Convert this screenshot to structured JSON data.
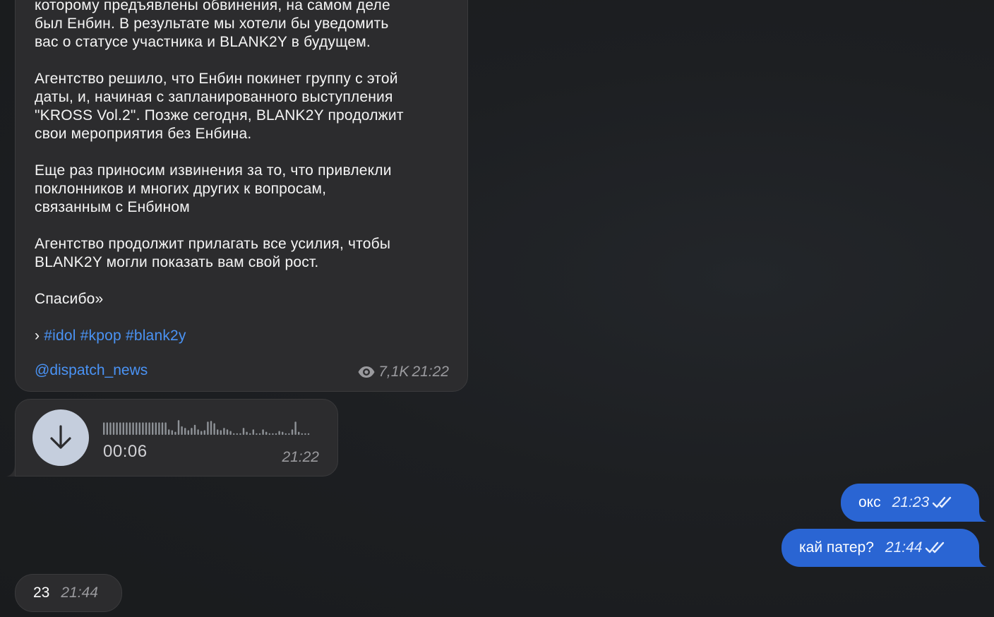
{
  "post": {
    "paragraphs": [
      [
        "которому предъявлены обвинения, на самом деле",
        "был Енбин. В результате мы хотели бы уведомить",
        "вас о статусе участника и BLANK2Y в будущем."
      ],
      [
        "Агентство решило, что Енбин покинет группу с этой",
        "даты, и, начиная с запланированного выступления",
        "\"KROSS Vol.2\". Позже сегодня, BLANK2Y продолжит",
        "свои мероприятия без Енбина."
      ],
      [
        "Еще раз приносим извинения за то, что привлекли",
        "поклонников и многих других к вопросам,",
        "связанным с Енбином"
      ],
      [
        "Агентство продолжит прилагать все усилия, чтобы",
        "BLANK2Y могли показать вам свой рост."
      ],
      [
        "Спасибо»"
      ]
    ],
    "hashtag_prefix": "›",
    "hashtags": [
      "#idol",
      "#kpop",
      "#blank2y"
    ],
    "channel": "@dispatch_news",
    "views": "7,1K",
    "time": "21:22",
    "views_icon": "eye-icon"
  },
  "voice": {
    "duration": "00:06",
    "time": "21:22",
    "icon": "download-arrow-icon",
    "waveform_levels": [
      0.8,
      0.8,
      0.8,
      0.8,
      0.8,
      0.8,
      0.8,
      0.8,
      0.8,
      0.8,
      0.8,
      0.8,
      0.8,
      0.8,
      0.8,
      0.8,
      0.8,
      0.8,
      0.8,
      0.8,
      0.35,
      0.3,
      0.2,
      0.95,
      0.55,
      0.45,
      0.3,
      0.45,
      0.65,
      0.35,
      0.25,
      0.3,
      0.85,
      0.9,
      0.75,
      0.35,
      0.3,
      0.45,
      0.35,
      0.25,
      0.1,
      0.1,
      0.1,
      0.45,
      0.2,
      0.1,
      0.35,
      0.1,
      0.1,
      0.35,
      0.2,
      0.1,
      0.1,
      0.1,
      0.25,
      0.2,
      0.1,
      0.1,
      0.35,
      0.85,
      0.2,
      0.1,
      0.1,
      0.1
    ],
    "colors": {
      "button": "#c5cedd",
      "wave": "#8e9297"
    }
  },
  "outgoing": [
    {
      "text": "окс",
      "time": "21:23",
      "status_icon": "double-check-icon"
    },
    {
      "text": "кай патер?",
      "time": "21:44",
      "status_icon": "double-check-icon"
    }
  ],
  "incoming_last": {
    "text": "23",
    "time": "21:44"
  },
  "colors": {
    "outgoing_bubble": "#2a65d3",
    "incoming_bubble": "#2c2c2e",
    "link": "#4a93f5"
  }
}
